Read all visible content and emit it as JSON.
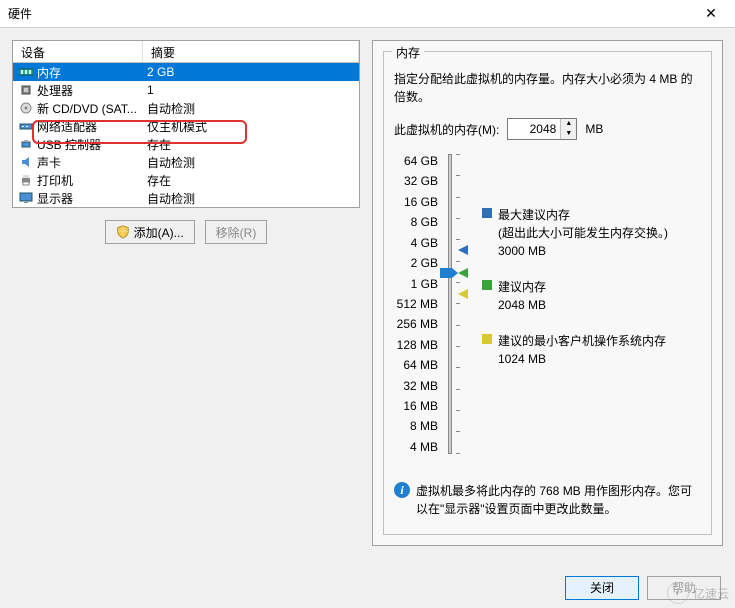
{
  "window": {
    "title": "硬件",
    "close_glyph": "✕"
  },
  "device_table": {
    "headers": {
      "device": "设备",
      "summary": "摘要"
    },
    "rows": [
      {
        "icon": "memory-icon",
        "name": "内存",
        "summary": "2 GB",
        "selected": true
      },
      {
        "icon": "cpu-icon",
        "name": "处理器",
        "summary": "1"
      },
      {
        "icon": "disc-icon",
        "name": "新 CD/DVD (SAT...",
        "summary": "自动检测"
      },
      {
        "icon": "network-icon",
        "name": "网络适配器",
        "summary": "仅主机模式",
        "highlighted": true
      },
      {
        "icon": "usb-icon",
        "name": "USB 控制器",
        "summary": "存在"
      },
      {
        "icon": "sound-icon",
        "name": "声卡",
        "summary": "自动检测"
      },
      {
        "icon": "printer-icon",
        "name": "打印机",
        "summary": "存在"
      },
      {
        "icon": "display-icon",
        "name": "显示器",
        "summary": "自动检测"
      }
    ]
  },
  "buttons": {
    "add": "添加(A)...",
    "remove": "移除(R)"
  },
  "memory_panel": {
    "group_title": "内存",
    "description": "指定分配给此虚拟机的内存量。内存大小必须为 4 MB 的倍数。",
    "input_label": "此虚拟机的内存(M):",
    "input_value": "2048",
    "unit": "MB",
    "slider_ticks": [
      "64 GB",
      "32 GB",
      "16 GB",
      "8 GB",
      "4 GB",
      "2 GB",
      "1 GB",
      "512 MB",
      "256 MB",
      "128 MB",
      "64 MB",
      "32 MB",
      "16 MB",
      "8 MB",
      "4 MB"
    ],
    "legends": {
      "max": {
        "color": "#2c6fbb",
        "title": "最大建议内存",
        "note": "(超出此大小可能发生内存交换。)",
        "value": "3000 MB"
      },
      "rec": {
        "color": "#3aa33a",
        "title": "建议内存",
        "value": "2048 MB"
      },
      "min": {
        "color": "#d8c832",
        "title": "建议的最小客户机操作系统内存",
        "value": "1024 MB"
      }
    },
    "info_text": "虚拟机最多将此内存的 768 MB 用作图形内存。您可以在\"显示器\"设置页面中更改此数量。"
  },
  "footer": {
    "close": "关闭",
    "help": "帮助"
  },
  "watermark": "亿速云"
}
